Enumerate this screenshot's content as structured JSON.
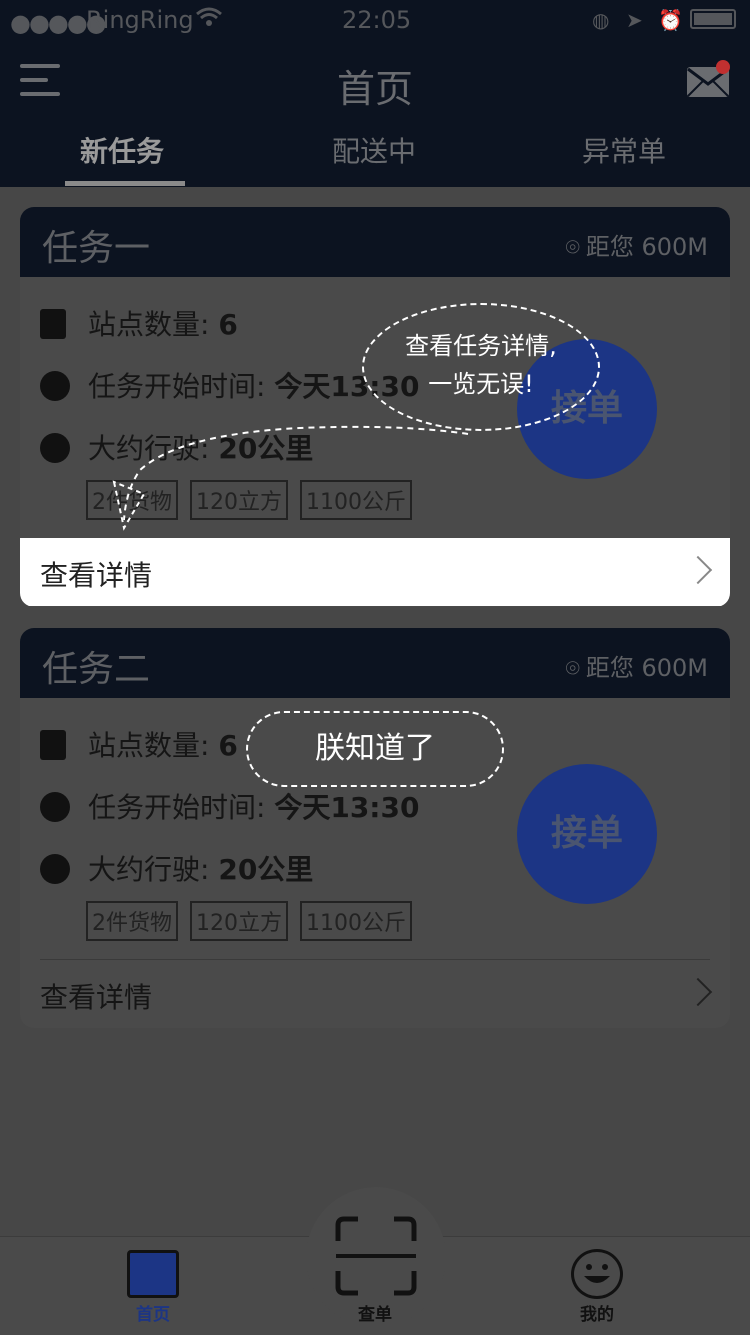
{
  "status_bar": {
    "signal": "●●●●●",
    "carrier": "RingRing",
    "time": "22:05"
  },
  "nav": {
    "title": "首页",
    "tabs": [
      {
        "label": "新任务",
        "active": true
      },
      {
        "label": "配送中",
        "active": false
      },
      {
        "label": "异常单",
        "active": false
      }
    ]
  },
  "tasks": [
    {
      "title": "任务一",
      "distance": "距您 600M",
      "stations_label": "站点数量:",
      "stations_value": "6",
      "start_label": "任务开始时间:",
      "start_value": "今天13:30",
      "drive_label": "大约行驶:",
      "drive_value": "20公里",
      "tags": [
        "2件货物",
        "120立方",
        "1100公斤"
      ],
      "accept_label": "接单",
      "detail_label": "查看详情"
    },
    {
      "title": "任务二",
      "distance": "距您 600M",
      "stations_label": "站点数量:",
      "stations_value": "6",
      "start_label": "任务开始时间:",
      "start_value": "今天13:30",
      "drive_label": "大约行驶:",
      "drive_value": "20公里",
      "tags": [
        "2件货物",
        "120立方",
        "1100公斤"
      ],
      "accept_label": "接单",
      "detail_label": "查看详情"
    }
  ],
  "guide": {
    "tip_line1": "查看任务详情,",
    "tip_line2": "一览无误!",
    "dismiss": "朕知道了"
  },
  "bottom_nav": {
    "items": [
      {
        "label": "首页",
        "icon": "home-icon",
        "active": true
      },
      {
        "label": "查单",
        "icon": "scan-icon",
        "active": false
      },
      {
        "label": "我的",
        "icon": "smile-icon",
        "active": false
      }
    ]
  },
  "colors": {
    "accent": "#1c3585",
    "header_bg": "#0c1320",
    "overlay": "#474747"
  }
}
